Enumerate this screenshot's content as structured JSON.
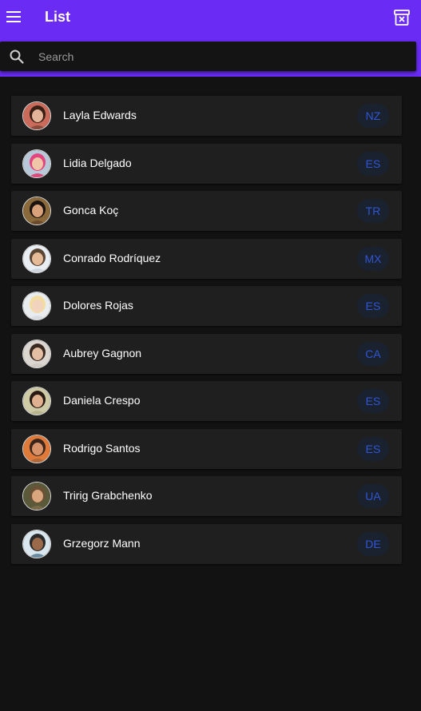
{
  "header": {
    "title": "List",
    "menu_icon": "menu-icon",
    "action_icon": "archive-x-icon",
    "color": "#6a2cf5"
  },
  "search": {
    "placeholder": "Search",
    "value": ""
  },
  "people": [
    {
      "name": "Layla Edwards",
      "country": "NZ",
      "avatar_color": "#8a4a3a",
      "hair": "#3a1f15",
      "skin": "#e2b59a",
      "bg": "#c96a5a"
    },
    {
      "name": "Lidia Delgado",
      "country": "ES",
      "avatar_color": "#d84a7a",
      "hair": "#e2457f",
      "skin": "#f0c6a8",
      "bg": "#b7c9d8"
    },
    {
      "name": "Gonca Koç",
      "country": "TR",
      "avatar_color": "#6a4a2a",
      "hair": "#1c1410",
      "skin": "#d9a27a",
      "bg": "#8a6a3a"
    },
    {
      "name": "Conrado Rodríquez",
      "country": "MX",
      "avatar_color": "#cfd6df",
      "hair": "#5a4634",
      "skin": "#e6bb98",
      "bg": "#e9eef3"
    },
    {
      "name": "Dolores Rojas",
      "country": "ES",
      "avatar_color": "#d9dde2",
      "hair": "#f2dca0",
      "skin": "#f2d3bd",
      "bg": "#e8ecef"
    },
    {
      "name": "Aubrey Gagnon",
      "country": "CA",
      "avatar_color": "#cfc9c4",
      "hair": "#3a2a22",
      "skin": "#e3bea2",
      "bg": "#dcd6d0"
    },
    {
      "name": "Daniela Crespo",
      "country": "ES",
      "avatar_color": "#b9b48e",
      "hair": "#2a1a14",
      "skin": "#e0b191",
      "bg": "#cfcaa6"
    },
    {
      "name": "Rodrigo Santos",
      "country": "ES",
      "avatar_color": "#b06a3a",
      "hair": "#3a261a",
      "skin": "#d8936a",
      "bg": "#e07a3a"
    },
    {
      "name": "Tririg Grabchenko",
      "country": "UA",
      "avatar_color": "#7a6a4a",
      "hair": "#6a5034",
      "skin": "#d9a67e",
      "bg": "#5a5a3a"
    },
    {
      "name": "Grzegorz Mann",
      "country": "DE",
      "avatar_color": "#6a8aa0",
      "hair": "#2a2a2a",
      "skin": "#9a6a4a",
      "bg": "#d9e6ee"
    }
  ]
}
